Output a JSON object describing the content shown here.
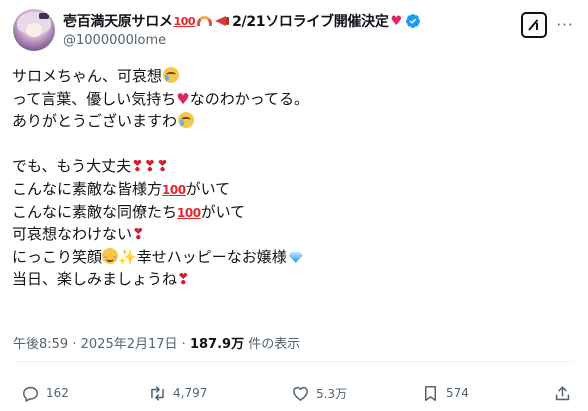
{
  "user": {
    "display_name": "壱百満天原サロメ",
    "hundred_emoji": "100",
    "event_text": "2/21ソロライブ開催決定",
    "handle": "@1000000lome"
  },
  "post": {
    "lines": [
      {
        "text": "サロメちゃん、可哀想",
        "emoji_after": "crying-face"
      },
      {
        "text_before": "って言葉、優しい気持ち",
        "emoji": "sparkling-heart",
        "text_after": "なのわかってる。"
      },
      {
        "text": "ありがとうございますわ",
        "emoji_after": "crying-face"
      },
      {
        "text": "でも、もう大丈夫",
        "exclaim": "❣❣❣"
      },
      {
        "text_before": "こんなに素敵な皆様方",
        "hundred": "100",
        "text_after": "がいて"
      },
      {
        "text_before": "こんなに素敵な同僚たち",
        "hundred": "100",
        "text_after": "がいて"
      },
      {
        "text": "可哀想なわけない",
        "exclaim": "❣"
      },
      {
        "text_before": "にっこり笑顔",
        "text_after": "幸せハッピーなお嬢様"
      },
      {
        "text": "当日、楽しみましょうね",
        "exclaim": "❣"
      }
    ]
  },
  "meta": {
    "time": "午後8:59",
    "date": "2025年2月17日",
    "separator": "·",
    "views": "187.9万",
    "views_label": "件の表示"
  },
  "actions": {
    "replies": "162",
    "reposts": "4,797",
    "likes": "5.3万",
    "bookmarks": "574"
  },
  "colors": {
    "text": "#0f1419",
    "secondary": "#536471",
    "verified": "#1d9bf0",
    "divider": "#eff3f4"
  }
}
